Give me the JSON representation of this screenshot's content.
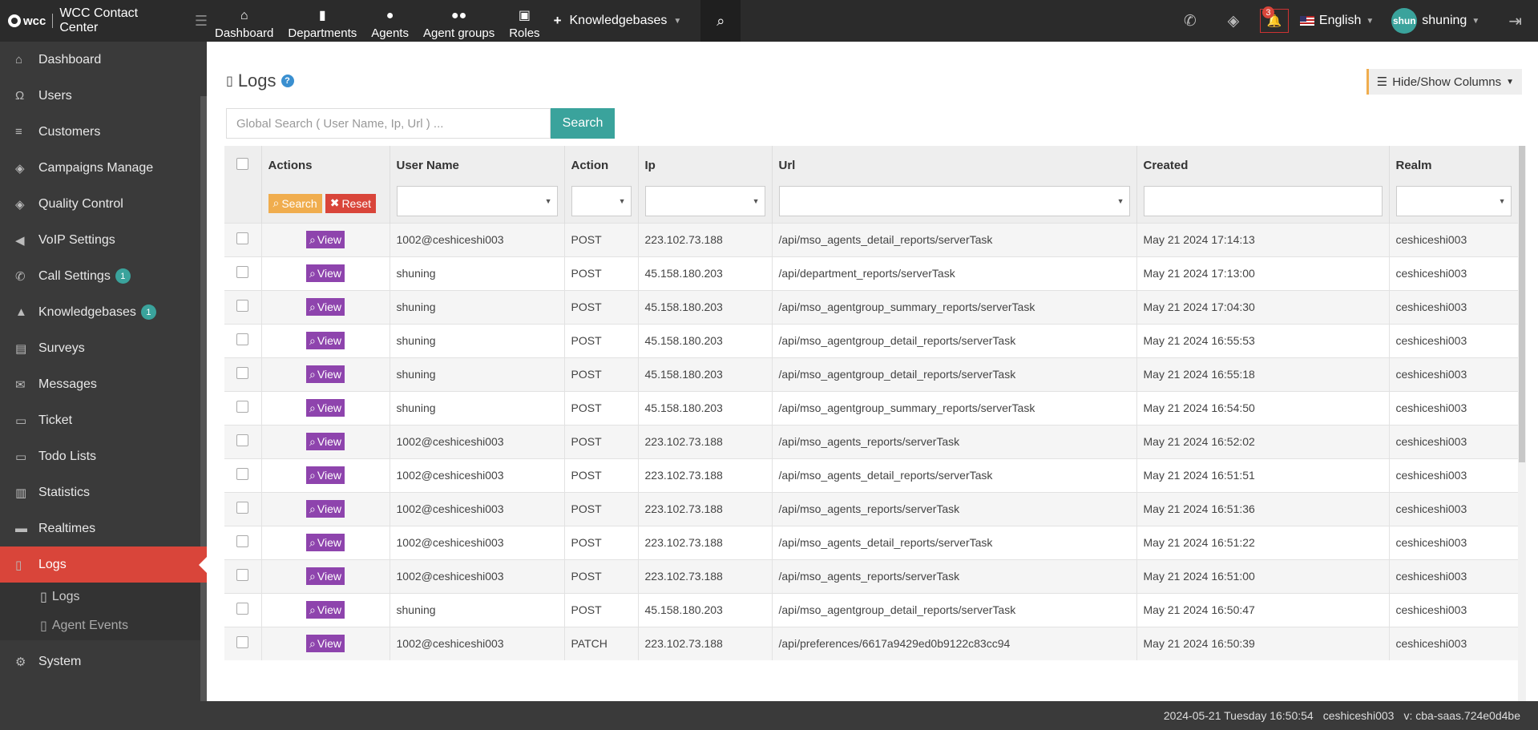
{
  "app": {
    "logo": "wcc",
    "title": "WCC Contact Center"
  },
  "topnav": {
    "items": [
      {
        "label": "Dashboard",
        "icon": "home-icon"
      },
      {
        "label": "Departments",
        "icon": "building-icon"
      },
      {
        "label": "Agents",
        "icon": "user-icon"
      },
      {
        "label": "Agent groups",
        "icon": "users-icon"
      },
      {
        "label": "Roles",
        "icon": "role-icon"
      }
    ],
    "knowledgebases": "Knowledgebases",
    "notification_count": "3",
    "language": "English",
    "user_initials": "shun",
    "user_name": "shuning"
  },
  "sidebar": {
    "items": [
      {
        "label": "Dashboard",
        "icon": "home-icon"
      },
      {
        "label": "Users",
        "icon": "omega-icon"
      },
      {
        "label": "Customers",
        "icon": "database-icon"
      },
      {
        "label": "Campaigns Manage",
        "icon": "layers-icon"
      },
      {
        "label": "Quality Control",
        "icon": "layers-icon"
      },
      {
        "label": "VoIP Settings",
        "icon": "volume-icon"
      },
      {
        "label": "Call Settings",
        "icon": "phone-icon",
        "count": "1"
      },
      {
        "label": "Knowledgebases",
        "icon": "graduation-icon",
        "count": "1"
      },
      {
        "label": "Surveys",
        "icon": "survey-icon"
      },
      {
        "label": "Messages",
        "icon": "envelope-icon"
      },
      {
        "label": "Ticket",
        "icon": "folder-icon"
      },
      {
        "label": "Todo Lists",
        "icon": "folder-icon"
      },
      {
        "label": "Statistics",
        "icon": "bar-chart-icon"
      },
      {
        "label": "Realtimes",
        "icon": "monitor-icon"
      },
      {
        "label": "Logs",
        "icon": "book-icon",
        "active": true
      }
    ],
    "sub_items": [
      {
        "label": "Logs"
      },
      {
        "label": "Agent Events"
      }
    ],
    "system": {
      "label": "System",
      "icon": "gear-icon"
    }
  },
  "page": {
    "title": "Logs",
    "hide_show_label": "Hide/Show Columns",
    "search_placeholder": "Global Search ( User Name,  Ip,  Url ) ...",
    "search_button": "Search",
    "filter_search": "Search",
    "filter_reset": "Reset",
    "view_label": "View"
  },
  "table": {
    "columns": [
      "Actions",
      "User Name",
      "Action",
      "Ip",
      "Url",
      "Created",
      "Realm"
    ],
    "rows": [
      {
        "user": "1002@ceshiceshi003",
        "action": "POST",
        "ip": "223.102.73.188",
        "url": "/api/mso_agents_detail_reports/serverTask",
        "created": "May 21 2024 17:14:13",
        "realm": "ceshiceshi003"
      },
      {
        "user": "shuning",
        "action": "POST",
        "ip": "45.158.180.203",
        "url": "/api/department_reports/serverTask",
        "created": "May 21 2024 17:13:00",
        "realm": "ceshiceshi003"
      },
      {
        "user": "shuning",
        "action": "POST",
        "ip": "45.158.180.203",
        "url": "/api/mso_agentgroup_summary_reports/serverTask",
        "created": "May 21 2024 17:04:30",
        "realm": "ceshiceshi003"
      },
      {
        "user": "shuning",
        "action": "POST",
        "ip": "45.158.180.203",
        "url": "/api/mso_agentgroup_detail_reports/serverTask",
        "created": "May 21 2024 16:55:53",
        "realm": "ceshiceshi003"
      },
      {
        "user": "shuning",
        "action": "POST",
        "ip": "45.158.180.203",
        "url": "/api/mso_agentgroup_detail_reports/serverTask",
        "created": "May 21 2024 16:55:18",
        "realm": "ceshiceshi003"
      },
      {
        "user": "shuning",
        "action": "POST",
        "ip": "45.158.180.203",
        "url": "/api/mso_agentgroup_summary_reports/serverTask",
        "created": "May 21 2024 16:54:50",
        "realm": "ceshiceshi003"
      },
      {
        "user": "1002@ceshiceshi003",
        "action": "POST",
        "ip": "223.102.73.188",
        "url": "/api/mso_agents_reports/serverTask",
        "created": "May 21 2024 16:52:02",
        "realm": "ceshiceshi003"
      },
      {
        "user": "1002@ceshiceshi003",
        "action": "POST",
        "ip": "223.102.73.188",
        "url": "/api/mso_agents_detail_reports/serverTask",
        "created": "May 21 2024 16:51:51",
        "realm": "ceshiceshi003"
      },
      {
        "user": "1002@ceshiceshi003",
        "action": "POST",
        "ip": "223.102.73.188",
        "url": "/api/mso_agents_reports/serverTask",
        "created": "May 21 2024 16:51:36",
        "realm": "ceshiceshi003"
      },
      {
        "user": "1002@ceshiceshi003",
        "action": "POST",
        "ip": "223.102.73.188",
        "url": "/api/mso_agents_detail_reports/serverTask",
        "created": "May 21 2024 16:51:22",
        "realm": "ceshiceshi003"
      },
      {
        "user": "1002@ceshiceshi003",
        "action": "POST",
        "ip": "223.102.73.188",
        "url": "/api/mso_agents_reports/serverTask",
        "created": "May 21 2024 16:51:00",
        "realm": "ceshiceshi003"
      },
      {
        "user": "shuning",
        "action": "POST",
        "ip": "45.158.180.203",
        "url": "/api/mso_agentgroup_detail_reports/serverTask",
        "created": "May 21 2024 16:50:47",
        "realm": "ceshiceshi003"
      },
      {
        "user": "1002@ceshiceshi003",
        "action": "PATCH",
        "ip": "223.102.73.188",
        "url": "/api/preferences/6617a9429ed0b9122c83cc94",
        "created": "May 21 2024 16:50:39",
        "realm": "ceshiceshi003"
      }
    ]
  },
  "footer": {
    "datetime": "2024-05-21 Tuesday 16:50:54",
    "realm": "ceshiceshi003",
    "version": "v: cba-saas.724e0d4be"
  }
}
